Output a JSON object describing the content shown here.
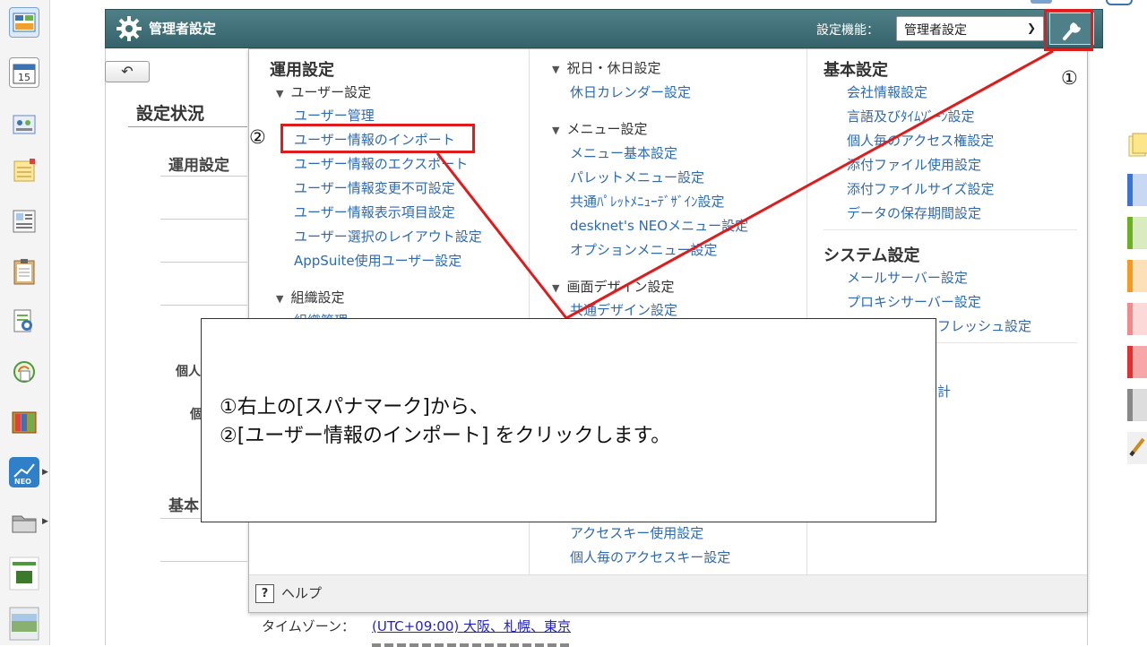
{
  "topbar": {
    "title": "管理者設定",
    "settings_label": "設定機能：",
    "select_value": "管理者設定"
  },
  "left_panel": {
    "heading": "設定状況",
    "section_unyou": "運用設定",
    "partial_kojin": "個人",
    "partial_ko": "個",
    "partial_kihon": "基本"
  },
  "menu": {
    "col1": {
      "heading": "運用設定",
      "user_group": "ユーザー設定",
      "user_links": [
        "ユーザー管理",
        "ユーザー情報のインポート",
        "ユーザー情報のエクスポート",
        "ユーザー情報変更不可設定",
        "ユーザー情報表示項目設定",
        "ユーザー選択のレイアウト設定",
        "AppSuite使用ユーザー設定"
      ],
      "org_group": "組織設定",
      "org_link_partial": "組織管理"
    },
    "col2": {
      "holiday_group": "祝日・休日設定",
      "holiday_link": "休日カレンダー設定",
      "menu_group": "メニュー設定",
      "menu_links": [
        "メニュー基本設定",
        "パレットメニュー設定",
        "共通ﾊﾟﾚｯﾄﾒﾆｭｰﾃﾞｻﾞｲﾝ設定",
        "desknet's NEOメニュー設定",
        "オプションメニュー設定"
      ],
      "design_group": "画面デザイン設定",
      "design_link": "共通デザイン設定",
      "access_links": [
        "アクセスキー使用設定",
        "個人毎のアクセスキー設定"
      ]
    },
    "col3": {
      "kihon_heading": "基本設定",
      "kihon_links": [
        "会社情報設定",
        "言語及びﾀｲﾑｿﾞｰﾝ設定",
        "個人毎のアクセス権設定",
        "添付ファイル使用設定",
        "添付ファイルサイズ設定",
        "データの保存期間設定"
      ],
      "system_heading": "システム設定",
      "system_links": [
        "メールサーバー設定",
        "プロキシサーバー設定",
        "フレッシュ設定"
      ],
      "partial_kei": "計"
    },
    "help": "ヘルプ"
  },
  "timezone": {
    "label": "タイムゾーン：",
    "value": "(UTC+09:00) 大阪、札幌、東京"
  },
  "annotations": {
    "num1": "①",
    "num2": "②",
    "line1": "①右上の[スパナマーク]から、",
    "line2": "②[ユーザー情報のインポート] をクリックします。"
  },
  "colors": {
    "accent_red": "#e01b1b",
    "topbar": "#3e6d75",
    "link_blue": "#2e6ab0"
  },
  "icons": [
    "gear-icon",
    "wrench-icon",
    "back-arrow-icon",
    "help-icon",
    "select-chevron-icon"
  ]
}
